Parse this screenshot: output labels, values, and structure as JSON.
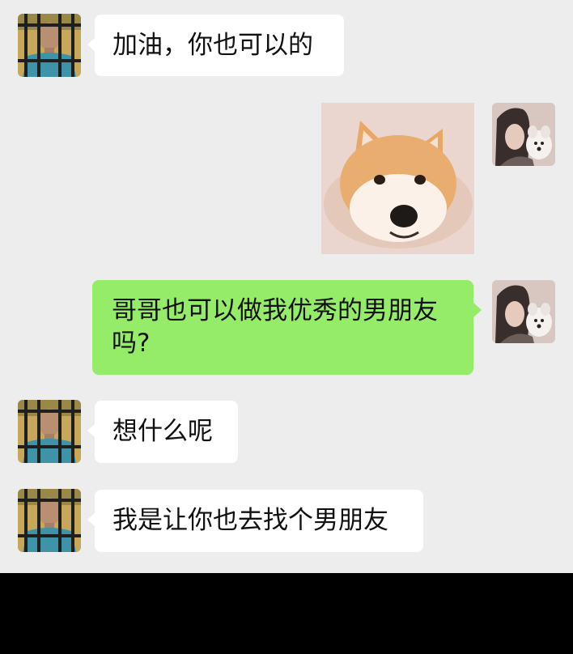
{
  "messages": [
    {
      "side": "left",
      "avatar": "prison-man-avatar",
      "text": "加油，你也可以的"
    },
    {
      "side": "right",
      "avatar": "girl-with-dog-avatar",
      "sticker": "shiba-inu-sticker"
    },
    {
      "side": "right",
      "avatar": "girl-with-dog-avatar",
      "text": "哥哥也可以做我优秀的男朋友吗?"
    },
    {
      "side": "left",
      "avatar": "prison-man-avatar",
      "text": "想什么呢"
    },
    {
      "side": "left",
      "avatar": "prison-man-avatar",
      "text": "我是让你也去找个男朋友"
    }
  ],
  "colors": {
    "chat_background": "#ededed",
    "incoming_bubble": "#ffffff",
    "outgoing_bubble": "#95ec69",
    "bottom_bar": "#000000"
  }
}
